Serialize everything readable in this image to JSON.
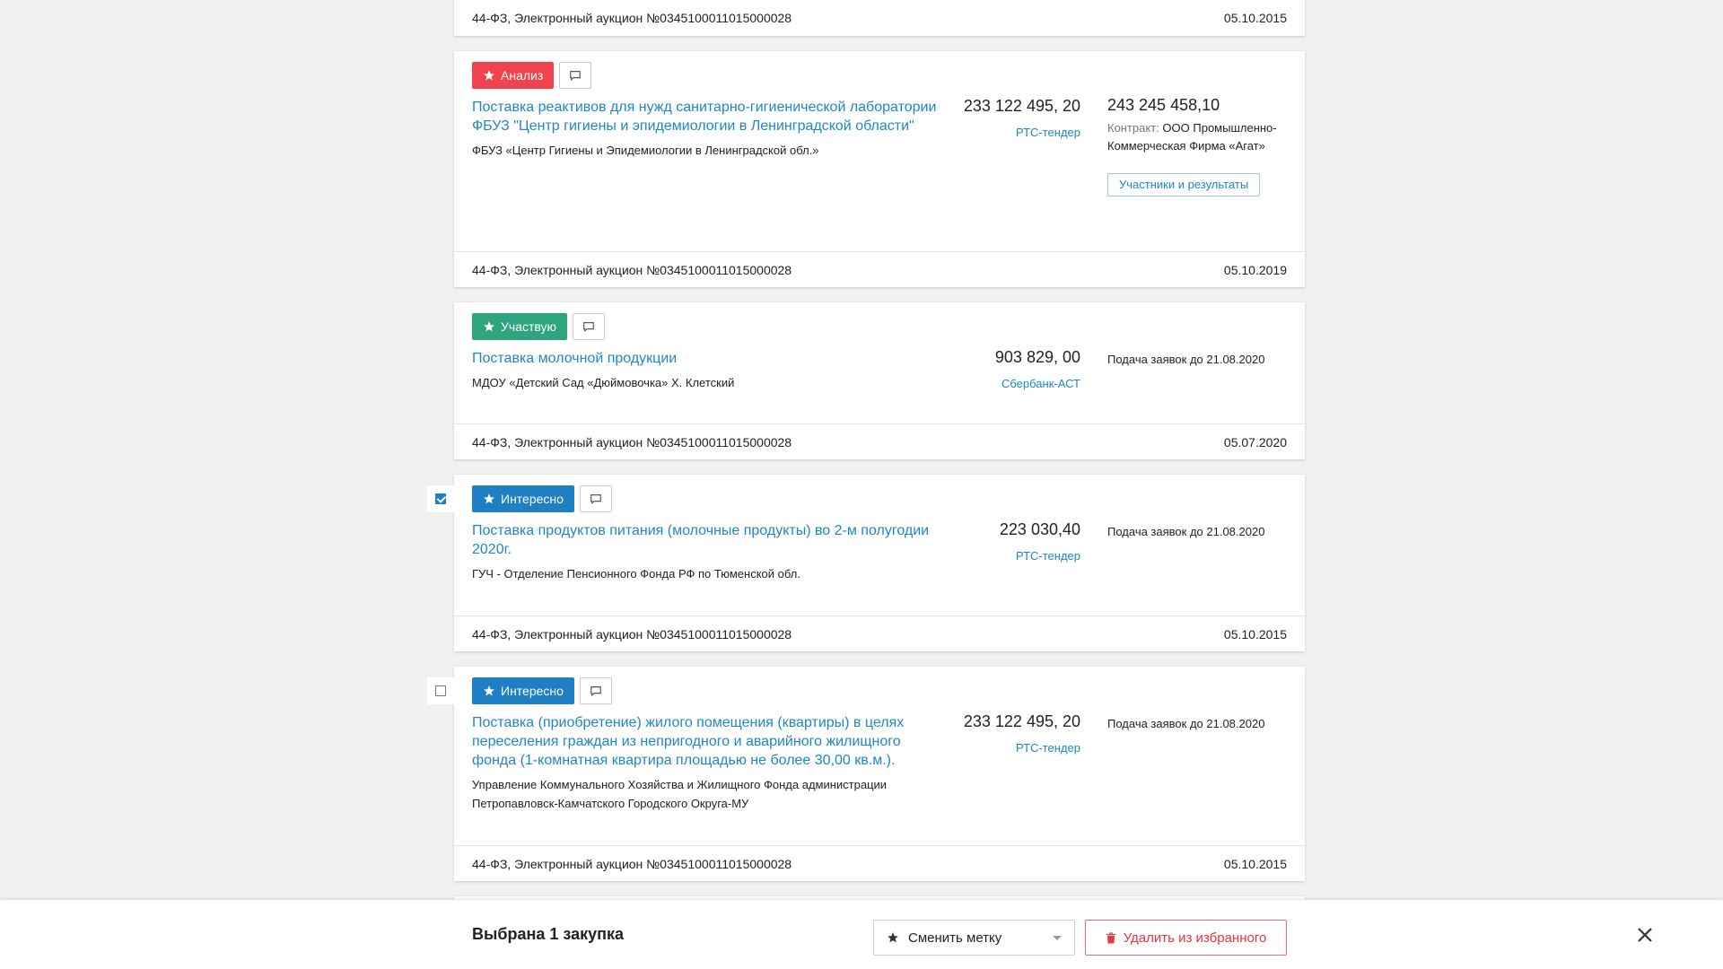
{
  "cards": [
    {
      "footer_law": "44-ФЗ, Электронный аукцион №0345100011015000028",
      "footer_date": "05.10.2015"
    },
    {
      "tag": "Анализ",
      "title": "Поставка реактивов для нужд санитарно-гигиенической лаборатории ФБУЗ \"Центр гигиены и эпидемиологии в Ленинградской области\"",
      "org": "ФБУЗ «Центр Гигиены и Эпидемиологии в Ленинградской обл.»",
      "price": "233 122 495, 20",
      "platform": "РТС-тендер",
      "contract_price": "243 245 458,10",
      "contract_label": "Контракт:",
      "contract_supplier": "ООО Промышленно-Коммерческая Фирма «Агат»",
      "participants_button": "Участники и результаты",
      "footer_law": "44-ФЗ, Электронный аукцион №0345100011015000028",
      "footer_date": "05.10.2019"
    },
    {
      "tag": "Участвую",
      "title": "Поставка молочной продукции",
      "org": "МДОУ «Детский Сад «Дюймовочка» Х. Клетский",
      "price": "903 829, 00",
      "platform": "Сбербанк-АСТ",
      "deadline": "Подача заявок до 21.08.2020",
      "footer_law": "44-ФЗ, Электронный аукцион №0345100011015000028",
      "footer_date": "05.07.2020"
    },
    {
      "tag": "Интересно",
      "checked": true,
      "title": "Поставка продуктов питания (молочные продукты) во 2-м полугодии 2020г.",
      "org": "ГУЧ - Отделение Пенсионного Фонда РФ по Тюменской обл.",
      "price": "223 030,40",
      "platform": "РТС-тендер",
      "deadline": "Подача заявок до 21.08.2020",
      "footer_law": "44-ФЗ, Электронный аукцион №0345100011015000028",
      "footer_date": "05.10.2015"
    },
    {
      "tag": "Интересно",
      "checked": false,
      "title": "Поставка (приобретение) жилого помещения (квартиры) в целях переселения граждан из непригодного и аварийного жилищного фонда (1-комнатная квартира площадью не более 30,00 кв.м.).",
      "org": "Управление Коммунального Хозяйства и Жилищного Фонда администрации Петропавловск-Камчатского Городского Округа-МУ",
      "price": "233 122 495, 20",
      "platform": "РТС-тендер",
      "deadline": "Подача заявок до 21.08.2020",
      "footer_law": "44-ФЗ, Электронный аукцион №0345100011015000028",
      "footer_date": "05.10.2015"
    }
  ],
  "action_bar": {
    "selected_text": "Выбрана 1 закупка",
    "change_label": "Сменить метку",
    "delete_label": "Удалить из избранного"
  },
  "colors": {
    "link": "#1f87c7",
    "tag_analysis": "#f0434d",
    "tag_participate": "#2fa57f",
    "tag_interesting": "#1f7fc4",
    "danger": "#e8353f"
  },
  "icons": [
    "star-icon",
    "comment-icon",
    "checkbox-icon",
    "chevron-down-icon",
    "trash-icon",
    "close-icon"
  ]
}
